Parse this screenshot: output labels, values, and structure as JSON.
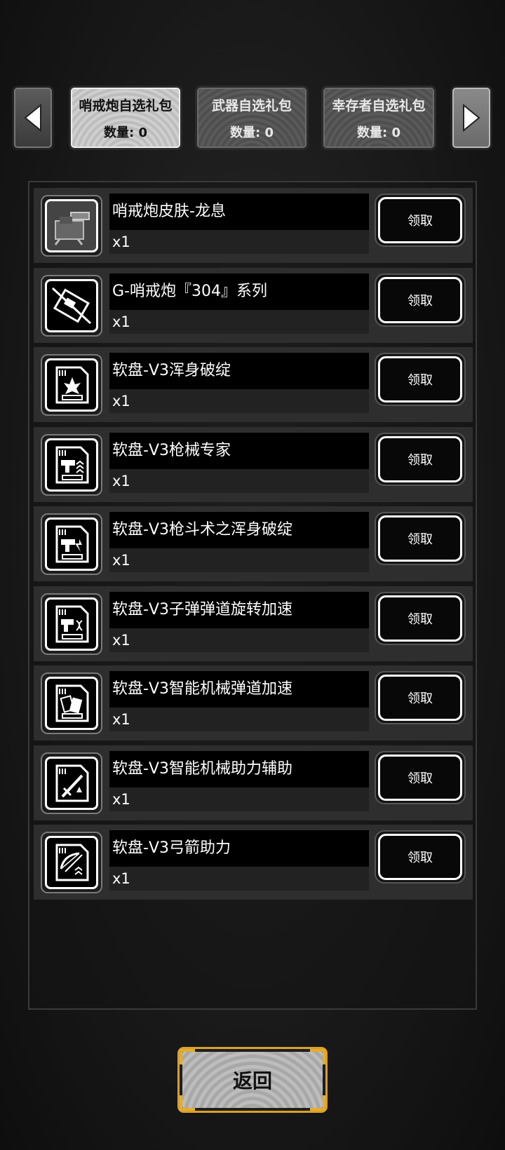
{
  "tabs": [
    {
      "title": "哨戒炮自选礼包",
      "count": "数量: 0",
      "active": true
    },
    {
      "title": "武器自选礼包",
      "count": "数量: 0",
      "active": false
    },
    {
      "title": "幸存者自选礼包",
      "count": "数量: 0",
      "active": false
    }
  ],
  "items": [
    {
      "name": "哨戒炮皮肤-龙息",
      "qty": "x1",
      "button": "领取",
      "icon": "turret-skin-icon"
    },
    {
      "name": "G-哨戒炮『304』系列",
      "qty": "x1",
      "button": "领取",
      "icon": "turret-304-icon"
    },
    {
      "name": "软盘-V3浑身破绽",
      "qty": "x1",
      "button": "领取",
      "icon": "floppy-flaw-icon"
    },
    {
      "name": "软盘-V3枪械专家",
      "qty": "x1",
      "button": "领取",
      "icon": "floppy-gun-expert-icon"
    },
    {
      "name": "软盘-V3枪斗术之浑身破绽",
      "qty": "x1",
      "button": "领取",
      "icon": "floppy-gunfight-icon"
    },
    {
      "name": "软盘-V3子弹弹道旋转加速",
      "qty": "x1",
      "button": "领取",
      "icon": "floppy-bullet-spin-icon"
    },
    {
      "name": "软盘-V3智能机械弹道加速",
      "qty": "x1",
      "button": "领取",
      "icon": "floppy-smart-mech-icon"
    },
    {
      "name": "软盘-V3智能机械助力辅助",
      "qty": "x1",
      "button": "领取",
      "icon": "floppy-sword-icon"
    },
    {
      "name": "软盘-V3弓箭助力",
      "qty": "x1",
      "button": "领取",
      "icon": "floppy-bow-icon"
    }
  ],
  "return_button": "返回",
  "colors": {
    "accent_gold": "#d8a12a"
  }
}
